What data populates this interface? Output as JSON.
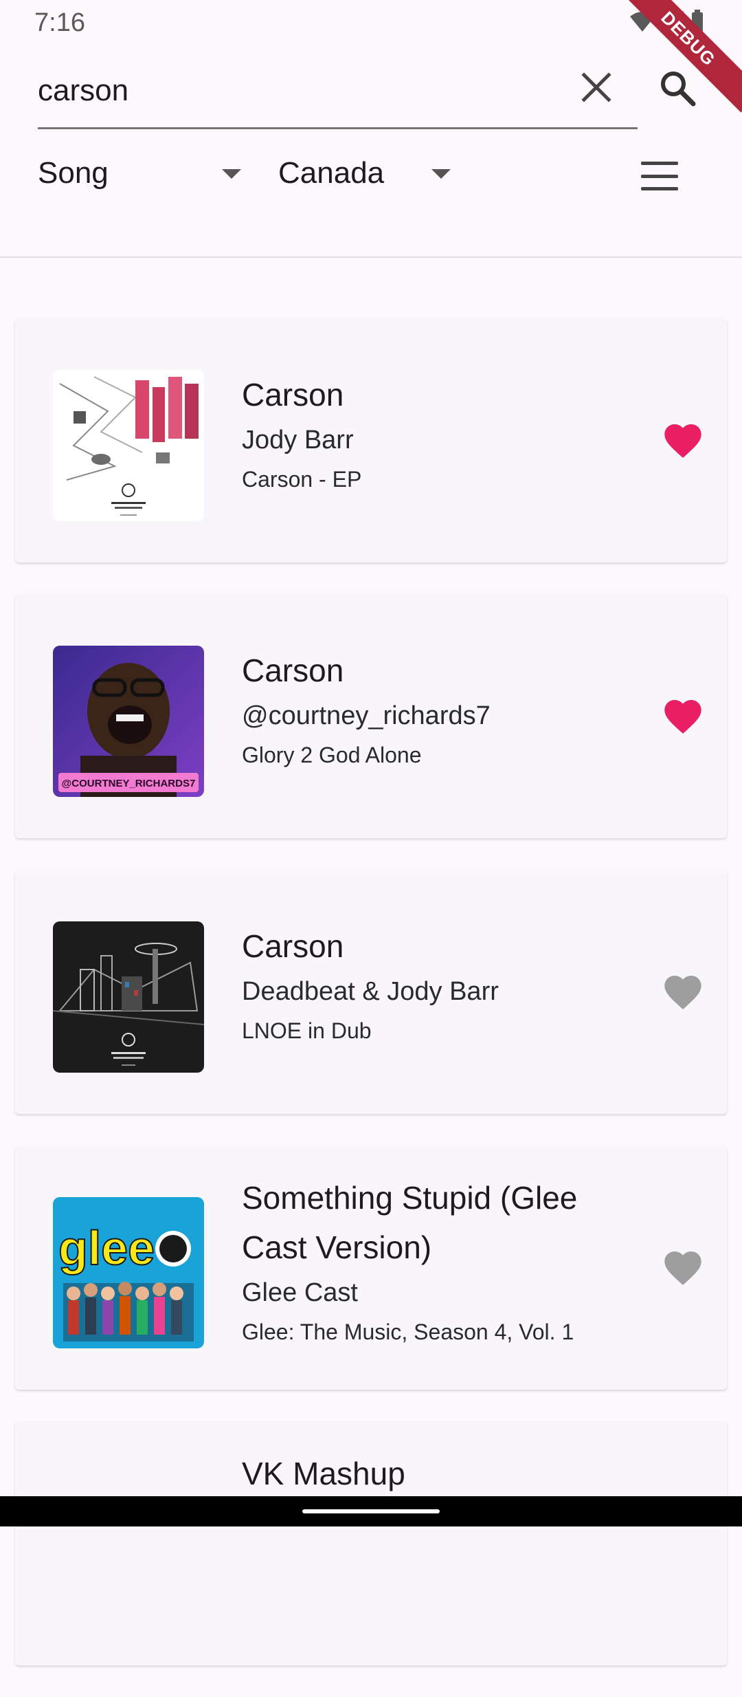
{
  "status": {
    "time": "7:16",
    "debug_label": "DEBUG"
  },
  "search": {
    "query": "carson"
  },
  "filters": {
    "type_label": "Song",
    "country_label": "Canada"
  },
  "results": [
    {
      "title": "Carson",
      "artist": "Jody Barr",
      "album": "Carson - EP",
      "favorite": true
    },
    {
      "title": "Carson",
      "artist": "@courtney_richards7",
      "album": "Glory 2 God Alone",
      "favorite": true,
      "art_text": "@COURTNEY_RICHARDS7"
    },
    {
      "title": "Carson",
      "artist": "Deadbeat & Jody Barr",
      "album": "LNOE in Dub",
      "favorite": false
    },
    {
      "title": "Something Stupid (Glee Cast Version)",
      "artist": "Glee Cast",
      "album": "Glee: The Music, Season 4, Vol. 1",
      "favorite": false,
      "art_text": "glee"
    },
    {
      "title": "VK Mashup"
    }
  ],
  "colors": {
    "favorite": "#e91e63",
    "not_favorite": "#9e9e9e",
    "accent": "#b0263a"
  }
}
